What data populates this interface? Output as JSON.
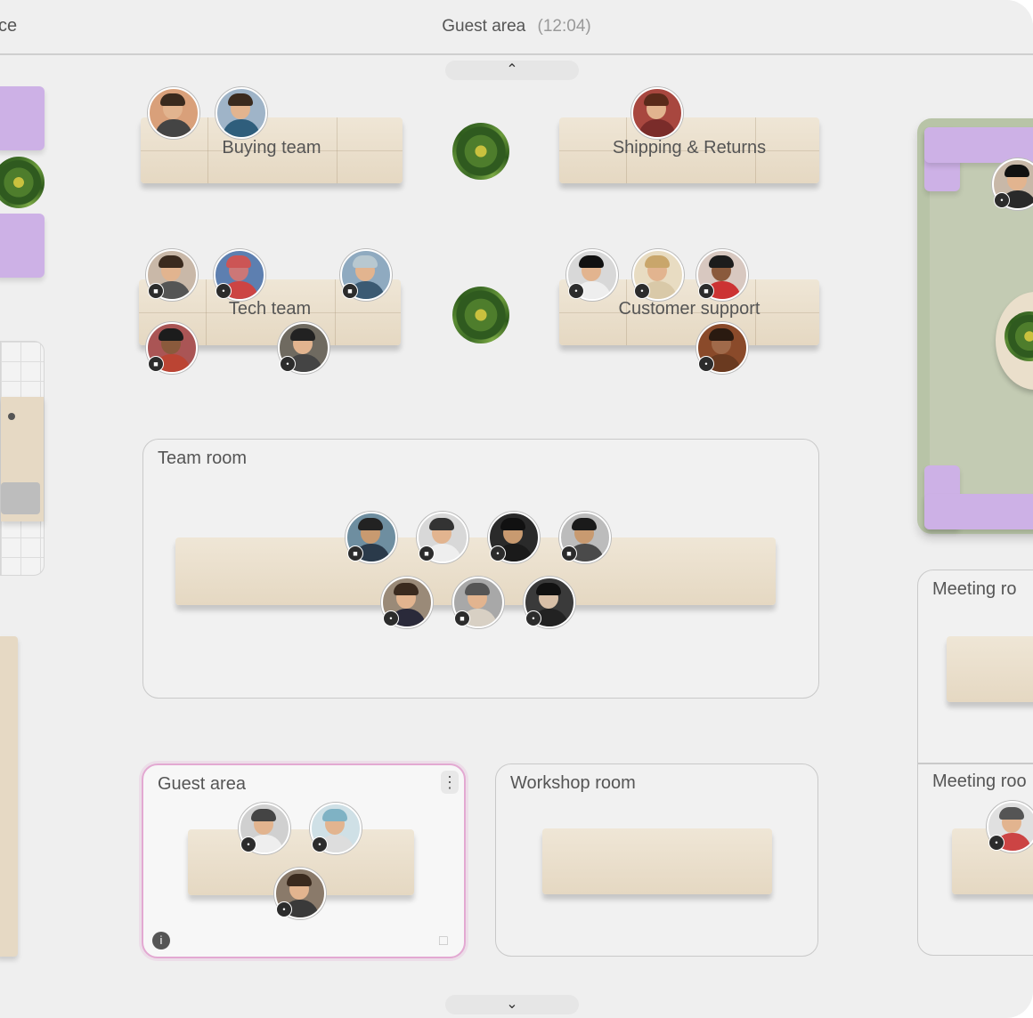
{
  "topbar": {
    "left_fragment": "ce",
    "title": "Guest area",
    "time": "(12:04)"
  },
  "scroll": {
    "up_icon": "chevron-up-icon",
    "down_icon": "chevron-down-icon"
  },
  "desks": [
    {
      "label": "Buying team"
    },
    {
      "label": "Shipping & Returns"
    },
    {
      "label": "Tech team"
    },
    {
      "label": "Customer support"
    }
  ],
  "rooms": {
    "team_room": "Team room",
    "guest_area": "Guest area",
    "workshop_room": "Workshop room",
    "meeting_room_1": "Meeting ro",
    "meeting_room_2": "Meeting roo"
  },
  "colors": {
    "background": "#efefef",
    "active_room_border": "#e3a9d2",
    "purple_furniture": "#cdb1e6",
    "desk_wood": "#e8dcc8",
    "lounge_green": "#b8c4a7"
  }
}
